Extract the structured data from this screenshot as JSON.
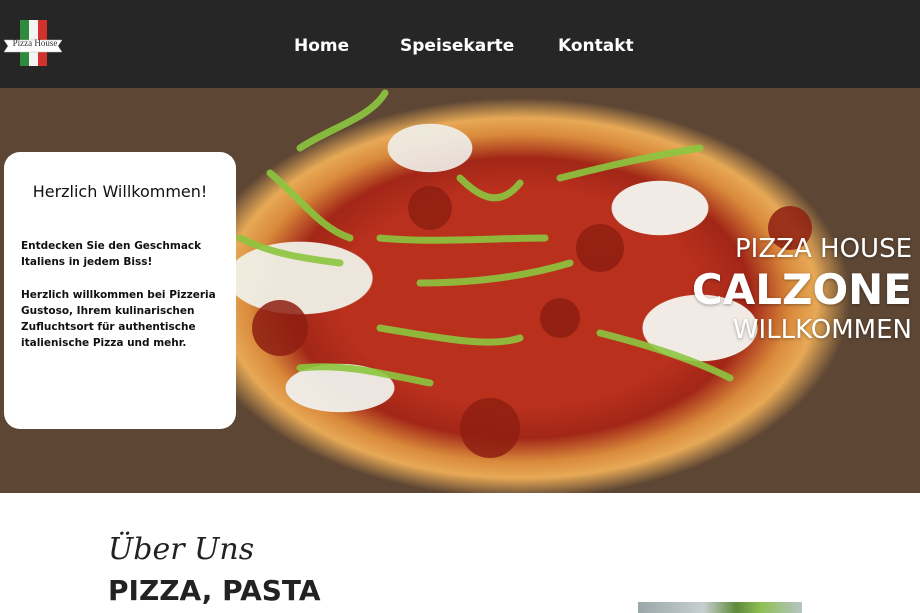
{
  "header": {
    "logo_text": "Pizza House",
    "nav": [
      {
        "label": "Home"
      },
      {
        "label": "Speisekarte"
      },
      {
        "label": "Kontakt"
      }
    ]
  },
  "hero": {
    "welcome": {
      "title": "Herzlich Willkommen!",
      "paragraph_1": "Entdecken Sie den Geschmack Italiens in jedem Biss!",
      "paragraph_2": "Herzlich willkommen bei Pizzeria Gustoso, Ihrem kulinarischen Zufluchtsort für authentische italienische Pizza und mehr."
    },
    "overlay_lines": [
      "PIZZA HOUSE",
      "CALZONE",
      "WILLKOMMEN"
    ]
  },
  "about": {
    "script_title": "Über Uns",
    "heading": "PIZZA, PASTA"
  },
  "colors": {
    "header_bg": "#262626",
    "card_bg": "#ffffff",
    "flag_green": "#2e8b3d",
    "flag_red": "#d2322d"
  }
}
